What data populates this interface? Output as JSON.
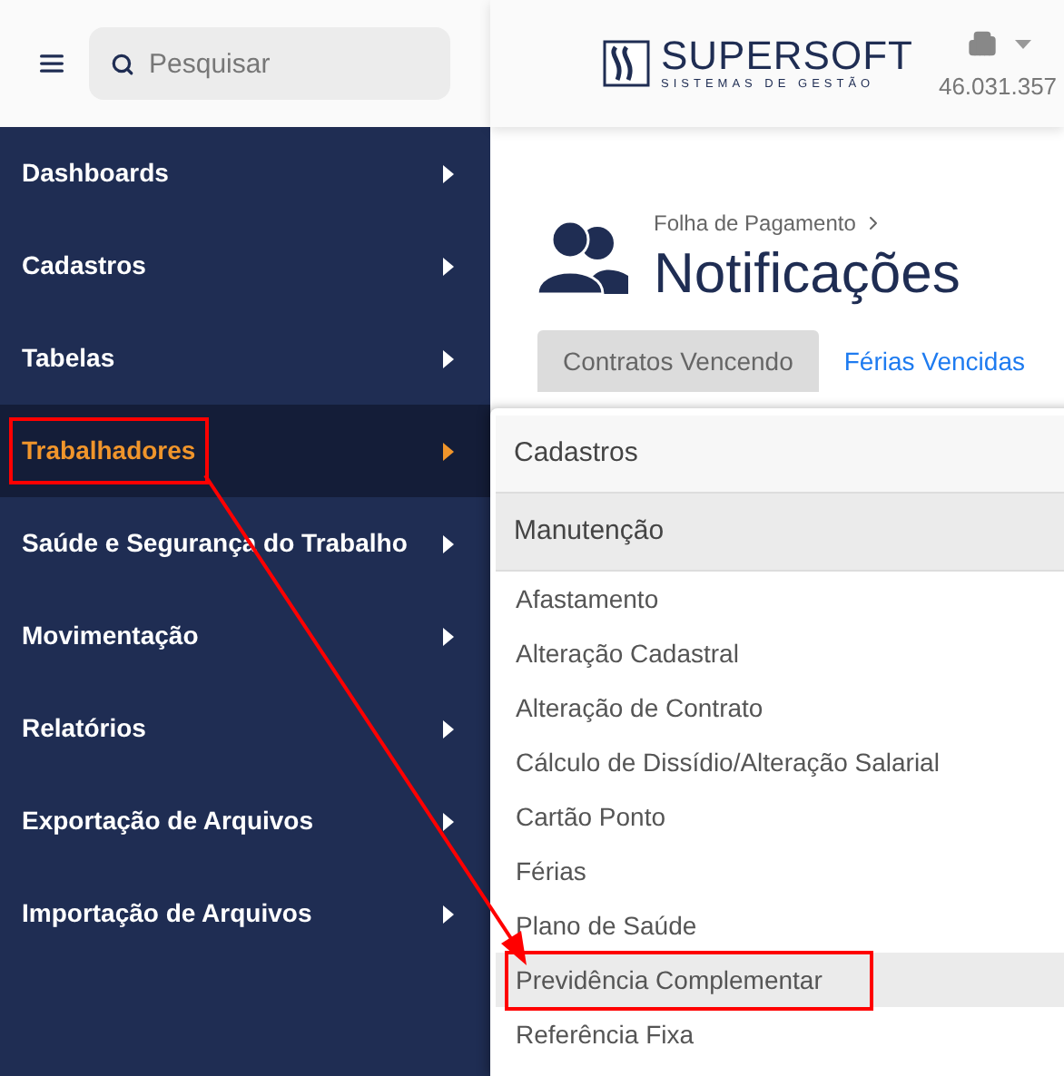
{
  "search": {
    "placeholder": "Pesquisar"
  },
  "logo": {
    "name": "SUPERSOFT",
    "tagline": "SISTEMAS DE GESTÃO"
  },
  "company": {
    "id": "46.031.357"
  },
  "sidebar": {
    "items": [
      {
        "label": "Dashboards",
        "selected": false,
        "annotated": false
      },
      {
        "label": "Cadastros",
        "selected": false,
        "annotated": false
      },
      {
        "label": "Tabelas",
        "selected": false,
        "annotated": false
      },
      {
        "label": "Trabalhadores",
        "selected": true,
        "annotated": true
      },
      {
        "label": "Saúde e Segurança do Trabalho",
        "selected": false,
        "annotated": false
      },
      {
        "label": "Movimentação",
        "selected": false,
        "annotated": false
      },
      {
        "label": "Relatórios",
        "selected": false,
        "annotated": false
      },
      {
        "label": "Exportação de Arquivos",
        "selected": false,
        "annotated": false
      },
      {
        "label": "Importação de Arquivos",
        "selected": false,
        "annotated": false
      }
    ]
  },
  "breadcrumb": "Folha de Pagamento",
  "page_title": "Notificações",
  "tabs": [
    {
      "label": "Contratos Vencendo",
      "selected": true
    },
    {
      "label": "Férias Vencidas",
      "selected": false
    }
  ],
  "submenu": {
    "sections": [
      {
        "label": "Cadastros",
        "expanded": false
      },
      {
        "label": "Manutenção",
        "expanded": true
      }
    ],
    "items": [
      {
        "label": "Afastamento",
        "selected": false,
        "annotated": false
      },
      {
        "label": "Alteração Cadastral",
        "selected": false,
        "annotated": false
      },
      {
        "label": "Alteração de Contrato",
        "selected": false,
        "annotated": false
      },
      {
        "label": "Cálculo de Dissídio/Alteração Salarial",
        "selected": false,
        "annotated": false
      },
      {
        "label": "Cartão Ponto",
        "selected": false,
        "annotated": false
      },
      {
        "label": "Férias",
        "selected": false,
        "annotated": false
      },
      {
        "label": "Plano de Saúde",
        "selected": false,
        "annotated": false
      },
      {
        "label": "Previdência Complementar",
        "selected": true,
        "annotated": true
      },
      {
        "label": "Referência Fixa",
        "selected": false,
        "annotated": false
      }
    ]
  }
}
